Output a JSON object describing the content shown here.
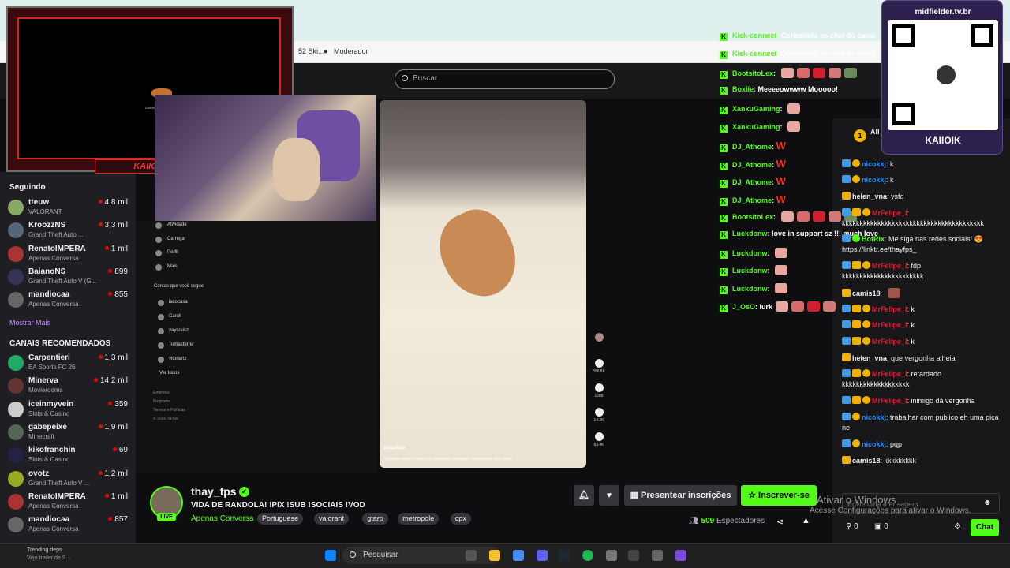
{
  "browser": {
    "bookmarks": [
      "52 Ski...",
      "Moderador"
    ]
  },
  "search": {
    "placeholder": "Buscar"
  },
  "sidebar": {
    "following_title": "Seguindo",
    "following": [
      {
        "name": "tteuw",
        "category": "VALORANT",
        "viewers": "4,8 mil",
        "color": "#8a6"
      },
      {
        "name": "KroozzNS",
        "category": "Grand Theft Auto ...",
        "viewers": "3,3 mil",
        "color": "#567"
      },
      {
        "name": "RenatoIMPERA",
        "category": "Apenas Conversa",
        "viewers": "1 mil",
        "color": "#a33"
      },
      {
        "name": "BaianoNS",
        "category": "Grand Theft Auto V (G...",
        "viewers": "899",
        "color": "#335"
      },
      {
        "name": "mandiocaa",
        "category": "Apenas Conversa",
        "viewers": "855",
        "color": "#666"
      }
    ],
    "show_more": "Mostrar Mais",
    "recommended_title": "CANAIS RECOMENDADOS",
    "recommended": [
      {
        "name": "Carpentieri",
        "category": "EA Sports FC 26",
        "viewers": "1,3 mil",
        "color": "#2a6"
      },
      {
        "name": "Minerva",
        "category": "Movierooms",
        "viewers": "14,2 mil",
        "color": "#633"
      },
      {
        "name": "iceinmyvein",
        "category": "Slots & Casino",
        "viewers": "359",
        "color": "#ccc"
      },
      {
        "name": "gabepeixe",
        "category": "Minecraft",
        "viewers": "1,9 mil",
        "color": "#565"
      },
      {
        "name": "kikofranchin",
        "category": "Slots & Casino",
        "viewers": "69",
        "color": "#224"
      },
      {
        "name": "ovotz",
        "category": "Grand Theft Auto V ...",
        "viewers": "1,2 mil",
        "color": "#9a2"
      },
      {
        "name": "RenatoIMPERA",
        "category": "Apenas Conversa",
        "viewers": "1 mil",
        "color": "#a33"
      },
      {
        "name": "mandiocaa",
        "category": "Apenas Conversa",
        "viewers": "857",
        "color": "#666"
      }
    ]
  },
  "overlay": {
    "brand": "KAIIOIK",
    "loading": "Looking for the player"
  },
  "tiktok": {
    "menu": [
      "Atividade",
      "Carregar",
      "Perfil",
      "Mais"
    ],
    "following_title": "Contas que você segue",
    "accounts": [
      "lacocasa",
      "Caroll",
      "yaysreisz",
      "Tomasferrer",
      "vitoriartz"
    ],
    "see_all": "Ver todos",
    "footer": [
      "Empresa",
      "Programa",
      "Termos e Políticas",
      "© 2026 TikTok"
    ],
    "video_user": "paty.duca",
    "video_caption": "Caminha macia e muito fofa #caminha #camapet #caminhapet #pet #pets",
    "counts": [
      "396.8K",
      "1288",
      "14.2K",
      "83.4K"
    ]
  },
  "overlay_chat": [
    {
      "user": "Kick-connect",
      "msg": "Conectado ao chat do canal",
      "emotes": 0
    },
    {
      "user": "Kick-connect",
      "msg": "Conectado ao chat do canal",
      "emotes": 0
    },
    {
      "user": "BootsitoLex",
      "msg": "",
      "emotes": 5
    },
    {
      "user": "Boxiie",
      "msg": "Meeeeowwww Mooooo!",
      "emotes": 0
    },
    {
      "user": "XankuGaming",
      "msg": "",
      "emotes": 1
    },
    {
      "user": "XankuGaming",
      "msg": "",
      "emotes": 1
    },
    {
      "user": "DJ_Athome",
      "msg": "W",
      "emotes": 0
    },
    {
      "user": "DJ_Athome",
      "msg": "W",
      "emotes": 0
    },
    {
      "user": "DJ_Athome",
      "msg": "W",
      "emotes": 0
    },
    {
      "user": "DJ_Athome",
      "msg": "W",
      "emotes": 0
    },
    {
      "user": "BootsitoLex",
      "msg": "",
      "emotes": 5
    },
    {
      "user": "Luckdonw",
      "msg": "love in support sz !!! much love",
      "emotes": 0
    },
    {
      "user": "Luckdonw",
      "msg": "",
      "emotes": 1
    },
    {
      "user": "Luckdonw",
      "msg": "",
      "emotes": 1
    },
    {
      "user": "Luckdonw",
      "msg": "",
      "emotes": 1
    },
    {
      "user": "J_OsO",
      "msg": "lurk",
      "emotes": 4
    }
  ],
  "qr": {
    "url": "midfielder.tv.br",
    "name": "KAIIOIK"
  },
  "chat": {
    "header_count": "1",
    "header_text": "All",
    "lines": [
      {
        "user": "nicokkj",
        "msg": "k",
        "color": "blue",
        "badges": "u c"
      },
      {
        "user": "nicokkj",
        "msg": "k",
        "color": "blue",
        "badges": "u c"
      },
      {
        "user": "helen_vna",
        "msg": "vsfd",
        "color": "gold",
        "badges": "y"
      },
      {
        "user": "MrFelipe_l",
        "msg": "kkkkkkkkkkkkkkkkkkkkkkkkkkkkkkkkkkkkkkkk",
        "color": "red",
        "badges": "u y c"
      },
      {
        "user": "BotRix",
        "msg": "Me siga nas redes sociais! 😍 https://linktr.ee/thayfps_",
        "color": "green",
        "badges": "u g"
      },
      {
        "user": "MrFelipe_l",
        "msg": "fdp kkkkkkkkkkkkkkkkkkkkkkk",
        "color": "red",
        "badges": "u y c"
      },
      {
        "user": "camis18",
        "msg": "",
        "color": "gold",
        "badges": "y"
      },
      {
        "user": "MrFelipe_l",
        "msg": "k",
        "color": "red",
        "badges": "u y c"
      },
      {
        "user": "MrFelipe_l",
        "msg": "k",
        "color": "red",
        "badges": "u y c"
      },
      {
        "user": "MrFelipe_l",
        "msg": "k",
        "color": "red",
        "badges": "u y c"
      },
      {
        "user": "helen_vna",
        "msg": "que vergonha alheia",
        "color": "gold",
        "badges": "y"
      },
      {
        "user": "MrFelipe_l",
        "msg": "retardado kkkkkkkkkkkkkkkkkkk",
        "color": "red",
        "badges": "u y c"
      },
      {
        "user": "MrFelipe_l",
        "msg": "inimigo dá vergonha",
        "color": "red",
        "badges": "u y c"
      },
      {
        "user": "nicokkj",
        "msg": "trabalhar com publico eh uma pica ne",
        "color": "blue",
        "badges": "u c"
      },
      {
        "user": "nicokkj",
        "msg": "pqp",
        "color": "blue",
        "badges": "u c"
      },
      {
        "user": "camis18",
        "msg": "kkkkkkkkk",
        "color": "gold",
        "badges": "y"
      }
    ],
    "input_placeholder": "Envie uma mensagem",
    "send_label": "Chat",
    "stat1": "0",
    "stat2": "0"
  },
  "stream": {
    "name": "thay_fps",
    "title": "VIDA DE RANDOLA! !PIX !SUB !SOCIAIS !VOD",
    "category": "Apenas Conversa",
    "tags": [
      "Portuguese",
      "valorant",
      "gtarp",
      "metropole",
      "cpx"
    ],
    "live": "LIVE",
    "gift_label": "Presentear inscrições",
    "sub_label": "Inscrever-se",
    "viewers": "509",
    "viewers_label": "Espectadores"
  },
  "watermark": {
    "line1": "Ativar o Windows",
    "line2": "Acesse Configurações para ativar o Windows."
  },
  "taskbar": {
    "search": "Pesquisar",
    "news": "Trending deps",
    "news2": "Veja trailer de S..."
  },
  "colors": {
    "kick_green": "#53fc18",
    "red": "#e9192f",
    "blue": "#1e90ff"
  }
}
